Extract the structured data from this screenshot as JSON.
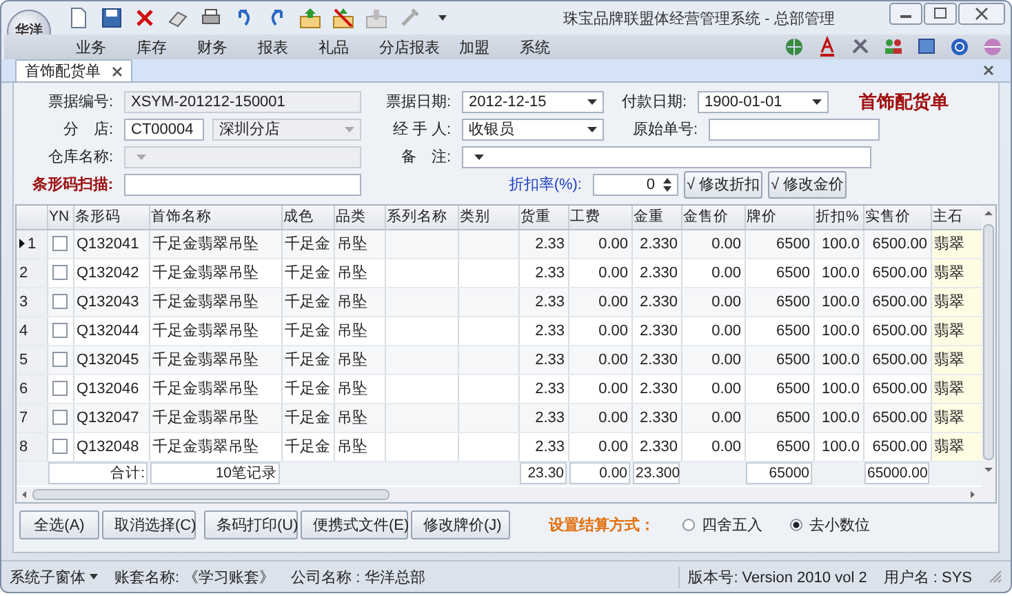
{
  "window": {
    "title": "珠宝品牌联盟体经营管理系统 - 总部管理",
    "logo": "华洋"
  },
  "menu": [
    "业务",
    "库存",
    "财务",
    "报表",
    "礼品",
    "分店报表",
    "加盟",
    "系统"
  ],
  "tabs": [
    {
      "label": "首饰配货单",
      "selected": true
    }
  ],
  "form": {
    "doc_no": {
      "label": "票据编号:",
      "value": "XSYM-201212-150001"
    },
    "doc_date": {
      "label": "票据日期:",
      "value": "2012-12-15"
    },
    "pay_date": {
      "label": "付款日期:",
      "value": "1900-01-01"
    },
    "heading": "首饰配货单",
    "branch": {
      "label": "分　店:",
      "code": "CT00004",
      "name": "深圳分店"
    },
    "handler": {
      "label": "经 手 人:",
      "value": "收银员"
    },
    "original_no": {
      "label": "原始单号:"
    },
    "warehouse": {
      "label": "仓库名称:"
    },
    "remark": {
      "label": "备　注:"
    },
    "barcode_scan": {
      "label": "条形码扫描:"
    },
    "discount": {
      "label": "折扣率(%):",
      "value": "0"
    },
    "buttons": [
      "√ 修改折扣",
      "√ 修改金价"
    ]
  },
  "table": {
    "columns": [
      "YN",
      "条形码",
      "首饰名称",
      "成色",
      "品类",
      "系列名称",
      "类别",
      "货重",
      "工费",
      "金重",
      "金售价",
      "牌价",
      "折扣%",
      "实售价",
      "主石"
    ],
    "rows": [
      {
        "no": "1",
        "current": true,
        "checked": false,
        "barcode": "Q132041",
        "name": "千足金翡翠吊坠",
        "purity": "千足金",
        "category": "吊坠",
        "weight": "2.33",
        "labor": "0.00",
        "gold_weight": "2.330",
        "gold_price": "0.00",
        "tag_price": "6500",
        "discount": "100.0",
        "sale_price": "6500.00",
        "stone": "翡翠"
      },
      {
        "no": "2",
        "current": false,
        "checked": false,
        "barcode": "Q132042",
        "name": "千足金翡翠吊坠",
        "purity": "千足金",
        "category": "吊坠",
        "weight": "2.33",
        "labor": "0.00",
        "gold_weight": "2.330",
        "gold_price": "0.00",
        "tag_price": "6500",
        "discount": "100.0",
        "sale_price": "6500.00",
        "stone": "翡翠"
      },
      {
        "no": "3",
        "current": false,
        "checked": false,
        "barcode": "Q132043",
        "name": "千足金翡翠吊坠",
        "purity": "千足金",
        "category": "吊坠",
        "weight": "2.33",
        "labor": "0.00",
        "gold_weight": "2.330",
        "gold_price": "0.00",
        "tag_price": "6500",
        "discount": "100.0",
        "sale_price": "6500.00",
        "stone": "翡翠"
      },
      {
        "no": "4",
        "current": false,
        "checked": false,
        "barcode": "Q132044",
        "name": "千足金翡翠吊坠",
        "purity": "千足金",
        "category": "吊坠",
        "weight": "2.33",
        "labor": "0.00",
        "gold_weight": "2.330",
        "gold_price": "0.00",
        "tag_price": "6500",
        "discount": "100.0",
        "sale_price": "6500.00",
        "stone": "翡翠"
      },
      {
        "no": "5",
        "current": false,
        "checked": false,
        "barcode": "Q132045",
        "name": "千足金翡翠吊坠",
        "purity": "千足金",
        "category": "吊坠",
        "weight": "2.33",
        "labor": "0.00",
        "gold_weight": "2.330",
        "gold_price": "0.00",
        "tag_price": "6500",
        "discount": "100.0",
        "sale_price": "6500.00",
        "stone": "翡翠"
      },
      {
        "no": "6",
        "current": false,
        "checked": false,
        "barcode": "Q132046",
        "name": "千足金翡翠吊坠",
        "purity": "千足金",
        "category": "吊坠",
        "weight": "2.33",
        "labor": "0.00",
        "gold_weight": "2.330",
        "gold_price": "0.00",
        "tag_price": "6500",
        "discount": "100.0",
        "sale_price": "6500.00",
        "stone": "翡翠"
      },
      {
        "no": "7",
        "current": false,
        "checked": false,
        "barcode": "Q132047",
        "name": "千足金翡翠吊坠",
        "purity": "千足金",
        "category": "吊坠",
        "weight": "2.33",
        "labor": "0.00",
        "gold_weight": "2.330",
        "gold_price": "0.00",
        "tag_price": "6500",
        "discount": "100.0",
        "sale_price": "6500.00",
        "stone": "翡翠"
      },
      {
        "no": "8",
        "current": false,
        "checked": false,
        "barcode": "Q132048",
        "name": "千足金翡翠吊坠",
        "purity": "千足金",
        "category": "吊坠",
        "weight": "2.33",
        "labor": "0.00",
        "gold_weight": "2.330",
        "gold_price": "0.00",
        "tag_price": "6500",
        "discount": "100.0",
        "sale_price": "6500.00",
        "stone": "翡翠"
      }
    ],
    "totals": {
      "label": "合计:",
      "records": "10笔记录",
      "weight": "23.30",
      "labor": "0.00",
      "gold_weight": "23.300",
      "tag_price": "65000",
      "sale_price": "65000.00"
    }
  },
  "actions": [
    "全选(A)",
    "取消选择(C)",
    "条码打印(U)",
    "便携式文件(E)",
    "修改牌价(J)"
  ],
  "rounding": {
    "label": "设置结算方式：",
    "options": [
      {
        "label": "四舍五入",
        "selected": false
      },
      {
        "label": "去小数位",
        "selected": true
      }
    ]
  },
  "status_bar": {
    "menu": "系统子窗体",
    "account": "账套名称: 《学习账套》",
    "company": "公司名称 : 华洋总部",
    "version": "版本号: Version 2010 vol 2",
    "user": "用户名 : SYS"
  }
}
